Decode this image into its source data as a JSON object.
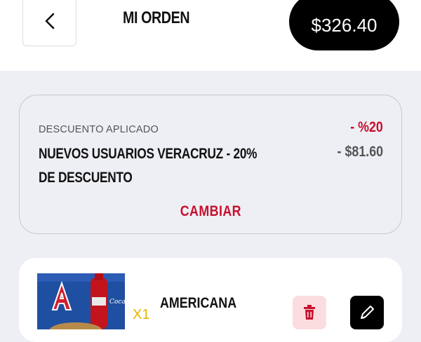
{
  "header": {
    "title": "MI ORDEN",
    "total": "$326.40"
  },
  "discount": {
    "label": "DESCUENTO APLICADO",
    "percent": "- %20",
    "name": "NUEVOS USUARIOS VERACRUZ - 20% DE DESCUENTO",
    "amount": "- $81.60",
    "change_label": "CAMBIAR"
  },
  "item": {
    "quantity": "X1",
    "name": "AMERICANA",
    "image_text": "Coca-Cola"
  },
  "colors": {
    "accent": "#c8102e",
    "background": "#eeeff4",
    "pill": "#000000"
  },
  "icons": {
    "back": "chevron-left-icon",
    "delete": "trash-icon",
    "edit": "pencil-icon"
  }
}
